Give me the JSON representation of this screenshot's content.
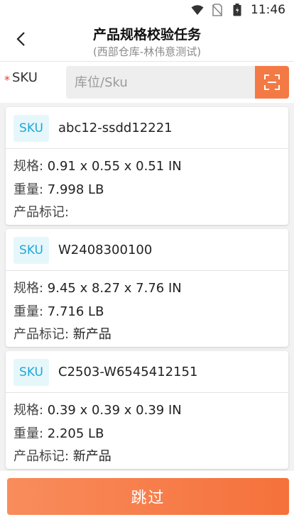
{
  "status_bar": {
    "time": "11:46"
  },
  "header": {
    "title": "产品规格校验任务",
    "subtitle": "(西部仓库-林伟意测试)"
  },
  "sku_field": {
    "label": "SKU",
    "required_mark": "*",
    "placeholder": "库位/Sku"
  },
  "field_labels": {
    "spec": "规格: ",
    "weight": "重量: ",
    "mark": "产品标记: "
  },
  "badge_label": "SKU",
  "products": [
    {
      "sku": "abc12-ssdd12221",
      "spec": "0.91 x 0.55 x 0.51 IN",
      "weight": "7.998 LB",
      "mark": ""
    },
    {
      "sku": "W2408300100",
      "spec": "9.45 x 8.27 x 7.76 IN",
      "weight": "7.716 LB",
      "mark": "新产品"
    },
    {
      "sku": "C2503-W6545412151",
      "spec": "0.39 x 0.39 x 0.39 IN",
      "weight": "2.205 LB",
      "mark": "新产品"
    }
  ],
  "footer": {
    "skip_label": "跳过"
  },
  "colors": {
    "accent": "#f5713b",
    "badge_text": "#1ea7d9",
    "badge_bg": "#e6f7fb",
    "required": "#e23c2c"
  }
}
